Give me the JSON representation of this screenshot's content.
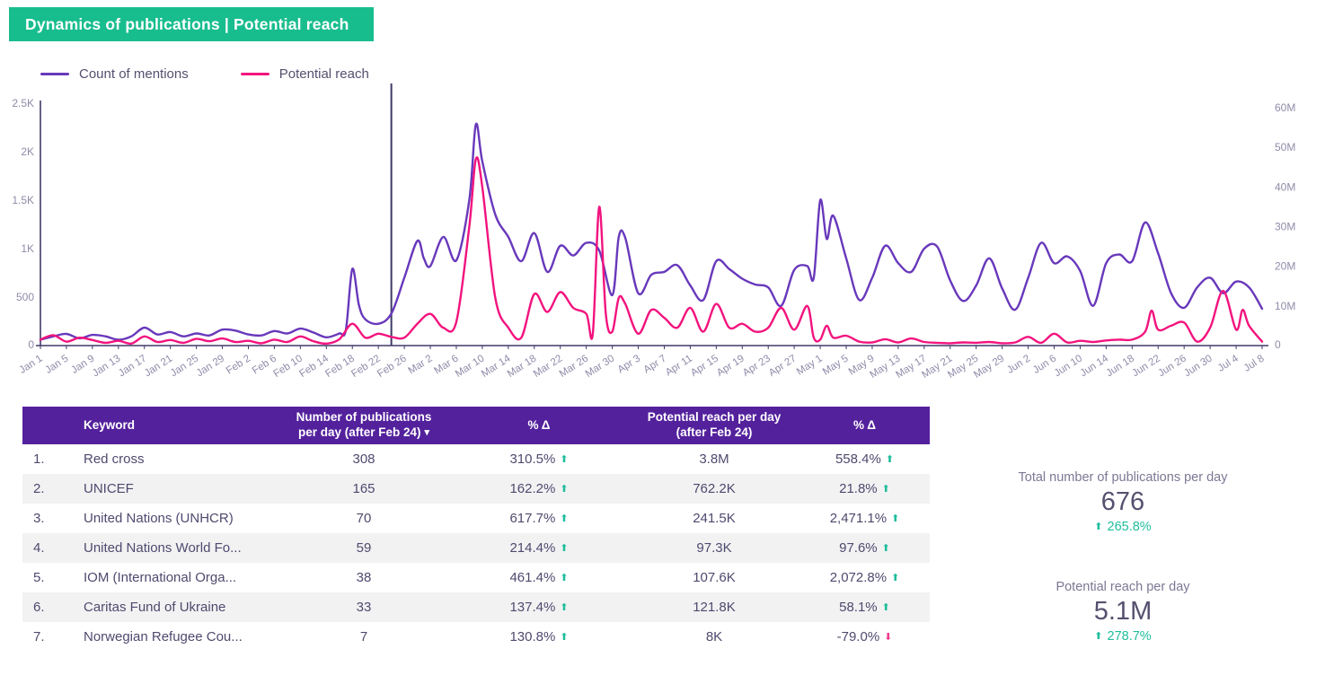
{
  "banner": {
    "title": "Dynamics of publications | Potential reach"
  },
  "legend": [
    {
      "label": "Count of mentions",
      "color": "#6838bb"
    },
    {
      "label": "Potential reach",
      "color": "#f2137e"
    }
  ],
  "colors": {
    "banner_green": "#18bd8e",
    "header_purple": "#54219d",
    "axis": "#3e3a68",
    "tick_label": "#8f8ca9",
    "up_green": "#1fbd9c",
    "down_pink": "#f43b8e"
  },
  "chart_data": {
    "type": "line",
    "title": "Dynamics of publications | Potential reach",
    "x_tick_labels": [
      "Jan 1",
      "Jan 5",
      "Jan 9",
      "Jan 13",
      "Jan 17",
      "Jan 21",
      "Jan 25",
      "Jan 29",
      "Feb 2",
      "Feb 6",
      "Feb 10",
      "Feb 14",
      "Feb 18",
      "Feb 22",
      "Feb 26",
      "Mar 2",
      "Mar 6",
      "Mar 10",
      "Mar 14",
      "Mar 18",
      "Mar 22",
      "Mar 26",
      "Mar 30",
      "Apr 3",
      "Apr 7",
      "Apr 11",
      "Apr 15",
      "Apr 19",
      "Apr 23",
      "Apr 27",
      "May 1",
      "May 5",
      "May 9",
      "May 13",
      "May 17",
      "May 21",
      "May 25",
      "May 29",
      "Jun 2",
      "Jun 6",
      "Jun 10",
      "Jun 14",
      "Jun 18",
      "Jun 22",
      "Jun 26",
      "Jun 30",
      "Jul 4",
      "Jul 8"
    ],
    "x_tick_step_days": 4,
    "x_range_days": [
      0,
      188
    ],
    "left_axis": {
      "tick_labels": [
        "2.5K",
        "2K",
        "1.5K",
        "1K",
        "500",
        "0"
      ],
      "tick_values": [
        2500,
        2000,
        1500,
        1000,
        500,
        0
      ],
      "max": 2500
    },
    "right_axis": {
      "tick_labels": [
        "60M",
        "50M",
        "40M",
        "30M",
        "20M",
        "10M",
        "0"
      ],
      "tick_values": [
        60,
        50,
        40,
        30,
        20,
        10,
        0
      ],
      "max": 60
    },
    "event_marker_day": 54,
    "legend_position": "top-left",
    "grid": false,
    "series": [
      {
        "name": "Count of mentions",
        "color": "#6838bb",
        "axis": "left",
        "unit": "mentions",
        "points": [
          [
            0,
            60
          ],
          [
            2,
            95
          ],
          [
            4,
            120
          ],
          [
            6,
            75
          ],
          [
            8,
            110
          ],
          [
            10,
            95
          ],
          [
            12,
            60
          ],
          [
            14,
            95
          ],
          [
            16,
            185
          ],
          [
            18,
            115
          ],
          [
            20,
            140
          ],
          [
            22,
            95
          ],
          [
            24,
            125
          ],
          [
            26,
            105
          ],
          [
            28,
            165
          ],
          [
            30,
            155
          ],
          [
            32,
            115
          ],
          [
            34,
            105
          ],
          [
            36,
            150
          ],
          [
            38,
            125
          ],
          [
            40,
            175
          ],
          [
            42,
            135
          ],
          [
            44,
            85
          ],
          [
            46,
            125
          ],
          [
            47,
            160
          ],
          [
            48,
            790
          ],
          [
            49,
            420
          ],
          [
            50,
            270
          ],
          [
            52,
            225
          ],
          [
            54,
            330
          ],
          [
            56,
            700
          ],
          [
            58,
            1080
          ],
          [
            59,
            900
          ],
          [
            60,
            820
          ],
          [
            62,
            1120
          ],
          [
            64,
            880
          ],
          [
            66,
            1500
          ],
          [
            67,
            2280
          ],
          [
            68,
            1900
          ],
          [
            70,
            1350
          ],
          [
            72,
            1120
          ],
          [
            74,
            870
          ],
          [
            76,
            1160
          ],
          [
            78,
            760
          ],
          [
            80,
            1030
          ],
          [
            82,
            930
          ],
          [
            84,
            1060
          ],
          [
            86,
            980
          ],
          [
            88,
            520
          ],
          [
            89,
            1120
          ],
          [
            90,
            1110
          ],
          [
            92,
            540
          ],
          [
            94,
            730
          ],
          [
            96,
            760
          ],
          [
            98,
            830
          ],
          [
            100,
            620
          ],
          [
            102,
            470
          ],
          [
            104,
            870
          ],
          [
            106,
            790
          ],
          [
            108,
            690
          ],
          [
            110,
            630
          ],
          [
            112,
            600
          ],
          [
            114,
            410
          ],
          [
            116,
            780
          ],
          [
            118,
            820
          ],
          [
            119,
            700
          ],
          [
            120,
            1500
          ],
          [
            121,
            1100
          ],
          [
            122,
            1340
          ],
          [
            124,
            900
          ],
          [
            126,
            470
          ],
          [
            128,
            700
          ],
          [
            130,
            1030
          ],
          [
            132,
            850
          ],
          [
            134,
            760
          ],
          [
            136,
            1000
          ],
          [
            138,
            1020
          ],
          [
            140,
            670
          ],
          [
            142,
            460
          ],
          [
            144,
            620
          ],
          [
            146,
            900
          ],
          [
            148,
            590
          ],
          [
            150,
            370
          ],
          [
            152,
            700
          ],
          [
            154,
            1060
          ],
          [
            156,
            850
          ],
          [
            158,
            920
          ],
          [
            160,
            770
          ],
          [
            162,
            410
          ],
          [
            164,
            850
          ],
          [
            166,
            940
          ],
          [
            168,
            870
          ],
          [
            170,
            1270
          ],
          [
            172,
            950
          ],
          [
            174,
            540
          ],
          [
            176,
            390
          ],
          [
            178,
            600
          ],
          [
            180,
            700
          ],
          [
            182,
            540
          ],
          [
            184,
            660
          ],
          [
            186,
            600
          ],
          [
            188,
            380
          ]
        ]
      },
      {
        "name": "Potential reach",
        "color": "#f2137e",
        "axis": "right",
        "unit": "M",
        "points": [
          [
            0,
            1.5
          ],
          [
            2,
            2.6
          ],
          [
            4,
            1.0
          ],
          [
            6,
            2.0
          ],
          [
            8,
            1.4
          ],
          [
            10,
            0.7
          ],
          [
            12,
            1.2
          ],
          [
            14,
            0.5
          ],
          [
            16,
            2.3
          ],
          [
            18,
            0.9
          ],
          [
            20,
            1.4
          ],
          [
            22,
            0.7
          ],
          [
            24,
            1.7
          ],
          [
            26,
            1.1
          ],
          [
            28,
            1.8
          ],
          [
            30,
            0.9
          ],
          [
            32,
            1.2
          ],
          [
            34,
            0.6
          ],
          [
            36,
            1.5
          ],
          [
            38,
            0.9
          ],
          [
            40,
            2.3
          ],
          [
            42,
            1.1
          ],
          [
            44,
            0.5
          ],
          [
            46,
            1.6
          ],
          [
            48,
            5.5
          ],
          [
            50,
            2.0
          ],
          [
            52,
            3.0
          ],
          [
            54,
            2.2
          ],
          [
            56,
            2.0
          ],
          [
            58,
            5.5
          ],
          [
            60,
            8.0
          ],
          [
            62,
            4.5
          ],
          [
            64,
            6.0
          ],
          [
            66,
            30
          ],
          [
            67,
            47
          ],
          [
            68,
            40
          ],
          [
            70,
            12
          ],
          [
            72,
            4.5
          ],
          [
            74,
            2.0
          ],
          [
            76,
            13
          ],
          [
            78,
            8.5
          ],
          [
            80,
            13.5
          ],
          [
            82,
            9.5
          ],
          [
            84,
            8.0
          ],
          [
            85,
            3.0
          ],
          [
            86,
            35
          ],
          [
            87,
            8.0
          ],
          [
            88,
            3.5
          ],
          [
            89,
            12
          ],
          [
            90,
            10.5
          ],
          [
            92,
            3.0
          ],
          [
            94,
            9.0
          ],
          [
            96,
            7.0
          ],
          [
            98,
            4.5
          ],
          [
            100,
            9.5
          ],
          [
            102,
            3.5
          ],
          [
            104,
            10.5
          ],
          [
            106,
            4.5
          ],
          [
            108,
            5.5
          ],
          [
            110,
            3.5
          ],
          [
            112,
            4.5
          ],
          [
            114,
            9.5
          ],
          [
            116,
            4.0
          ],
          [
            118,
            10.0
          ],
          [
            119,
            2.0
          ],
          [
            120,
            1.5
          ],
          [
            121,
            5.0
          ],
          [
            122,
            2.0
          ],
          [
            124,
            2.5
          ],
          [
            126,
            1.0
          ],
          [
            128,
            0.8
          ],
          [
            130,
            1.6
          ],
          [
            132,
            0.8
          ],
          [
            134,
            1.8
          ],
          [
            136,
            0.9
          ],
          [
            138,
            0.7
          ],
          [
            140,
            0.6
          ],
          [
            142,
            0.8
          ],
          [
            144,
            0.7
          ],
          [
            146,
            0.9
          ],
          [
            148,
            0.6
          ],
          [
            150,
            0.8
          ],
          [
            152,
            2.2
          ],
          [
            154,
            0.7
          ],
          [
            156,
            3.0
          ],
          [
            158,
            0.8
          ],
          [
            160,
            1.2
          ],
          [
            162,
            0.9
          ],
          [
            164,
            1.3
          ],
          [
            166,
            1.5
          ],
          [
            168,
            1.5
          ],
          [
            170,
            3.5
          ],
          [
            171,
            8.8
          ],
          [
            172,
            4.0
          ],
          [
            174,
            5.0
          ],
          [
            176,
            5.8
          ],
          [
            178,
            1.0
          ],
          [
            180,
            4.5
          ],
          [
            182,
            13.8
          ],
          [
            184,
            4.0
          ],
          [
            185,
            9.0
          ],
          [
            186,
            5.0
          ],
          [
            188,
            1.0
          ]
        ]
      }
    ]
  },
  "table": {
    "headers": {
      "keyword": "Keyword",
      "pubs": "Number of publications per day (after Feb 24)",
      "delta1": "% Δ",
      "reach": "Potential reach per day (after Feb 24)",
      "delta2": "% Δ"
    },
    "sort_caret": "▾",
    "rows": [
      {
        "rank": "1.",
        "keyword": "Red cross",
        "pubs": "308",
        "delta1": "310.5%",
        "delta1_dir": "up",
        "reach": "3.8M",
        "delta2": "558.4%",
        "delta2_dir": "up"
      },
      {
        "rank": "2.",
        "keyword": "UNICEF",
        "pubs": "165",
        "delta1": "162.2%",
        "delta1_dir": "up",
        "reach": "762.2K",
        "delta2": "21.8%",
        "delta2_dir": "up"
      },
      {
        "rank": "3.",
        "keyword": "United Nations (UNHCR)",
        "pubs": "70",
        "delta1": "617.7%",
        "delta1_dir": "up",
        "reach": "241.5K",
        "delta2": "2,471.1%",
        "delta2_dir": "up"
      },
      {
        "rank": "4.",
        "keyword": "United Nations World Fo...",
        "pubs": "59",
        "delta1": "214.4%",
        "delta1_dir": "up",
        "reach": "97.3K",
        "delta2": "97.6%",
        "delta2_dir": "up"
      },
      {
        "rank": "5.",
        "keyword": "IOM (International Orga...",
        "pubs": "38",
        "delta1": "461.4%",
        "delta1_dir": "up",
        "reach": "107.6K",
        "delta2": "2,072.8%",
        "delta2_dir": "up"
      },
      {
        "rank": "6.",
        "keyword": "Caritas Fund of Ukraine",
        "pubs": "33",
        "delta1": "137.4%",
        "delta1_dir": "up",
        "reach": "121.8K",
        "delta2": "58.1%",
        "delta2_dir": "up"
      },
      {
        "rank": "7.",
        "keyword": "Norwegian Refugee Cou...",
        "pubs": "7",
        "delta1": "130.8%",
        "delta1_dir": "up",
        "reach": "8K",
        "delta2": "-79.0%",
        "delta2_dir": "down"
      }
    ]
  },
  "summary": [
    {
      "label": "Total number of publications per day",
      "value": "676",
      "delta": "265.8%",
      "delta_dir": "up"
    },
    {
      "label": "Potential reach per day",
      "value": "5.1M",
      "delta": "278.7%",
      "delta_dir": "up"
    }
  ]
}
